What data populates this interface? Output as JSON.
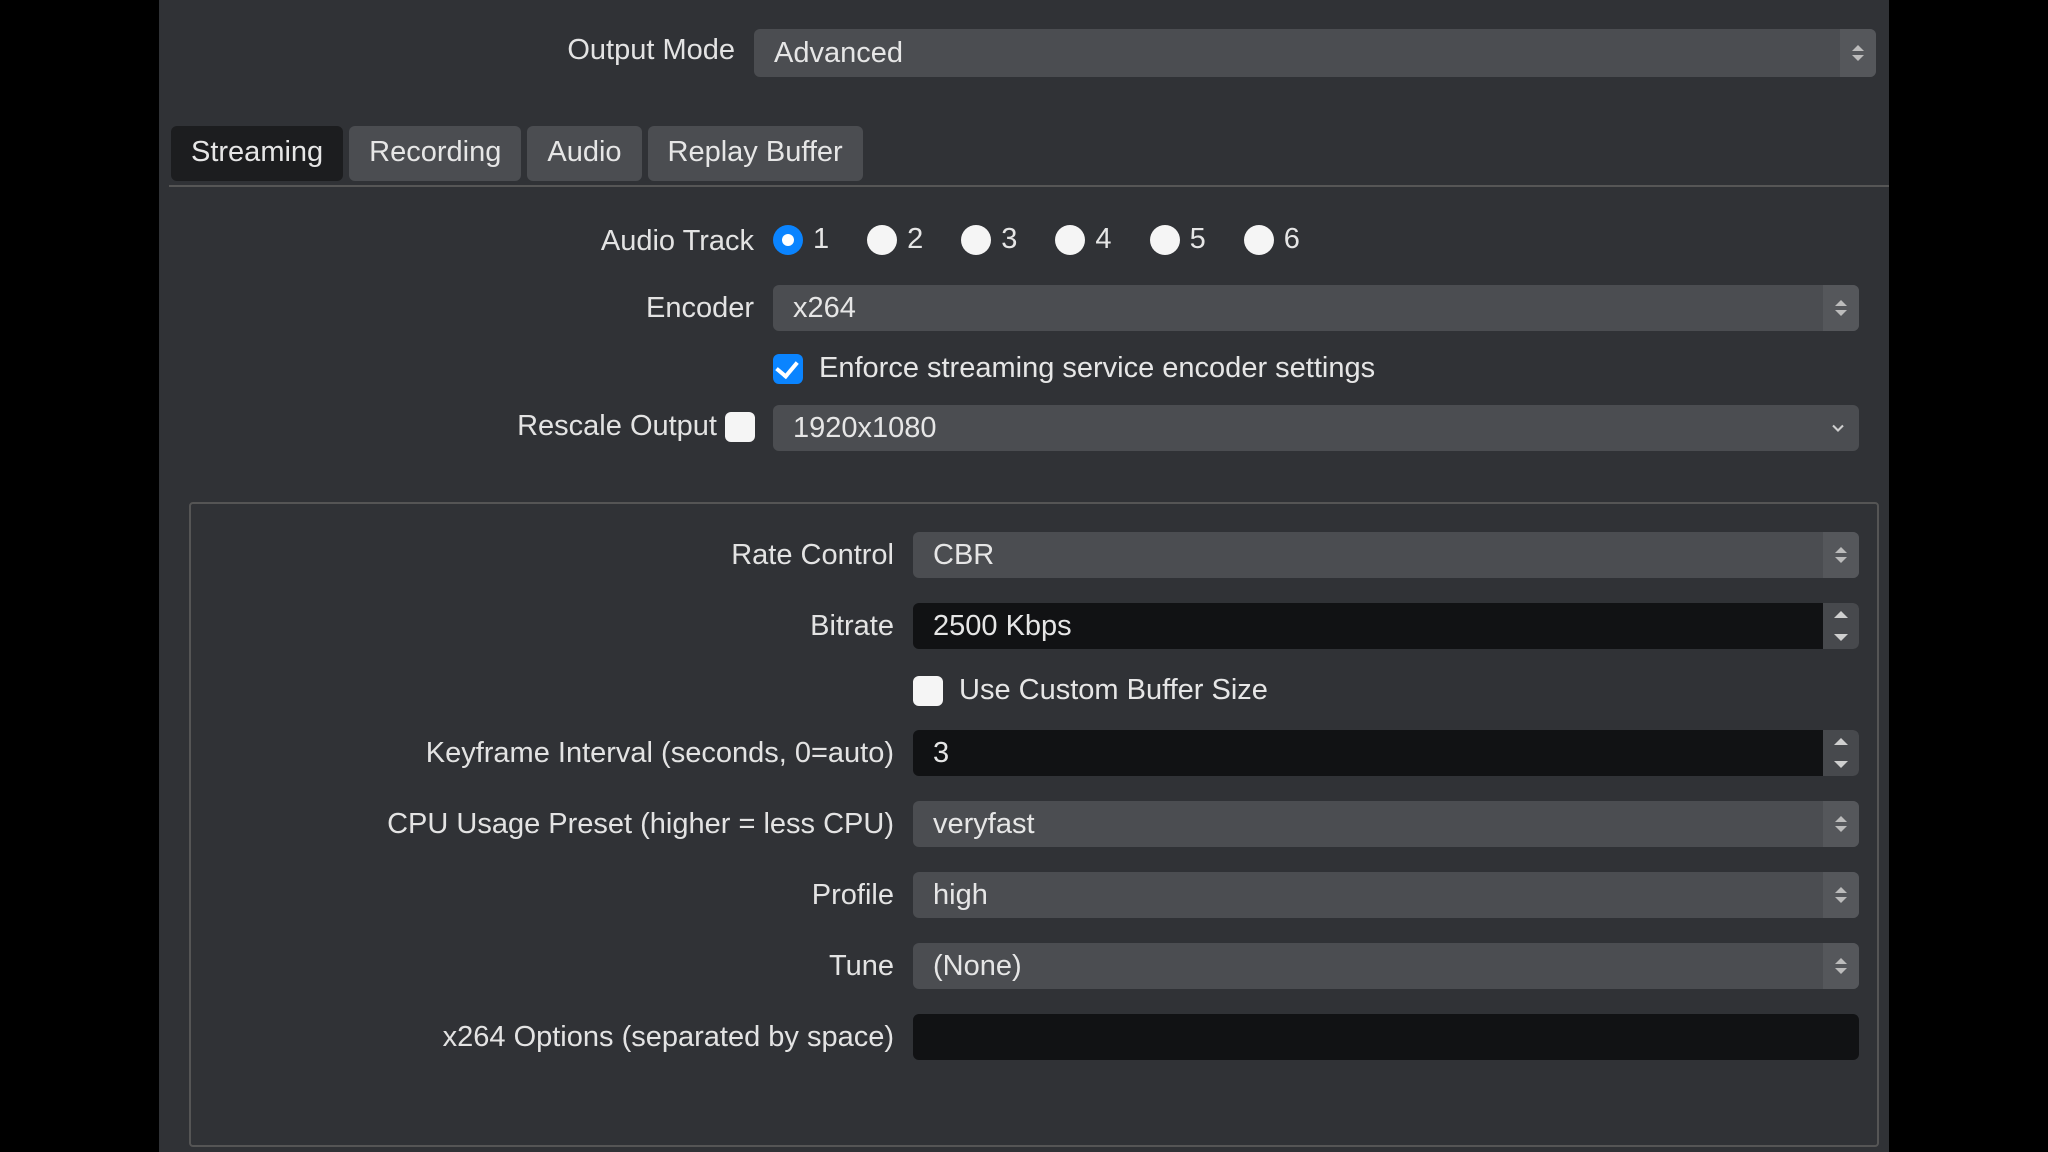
{
  "outputMode": {
    "label": "Output Mode",
    "value": "Advanced"
  },
  "tabs": {
    "streaming": "Streaming",
    "recording": "Recording",
    "audio": "Audio",
    "replayBuffer": "Replay Buffer",
    "active": "streaming"
  },
  "audioTrack": {
    "label": "Audio Track",
    "options": [
      "1",
      "2",
      "3",
      "4",
      "5",
      "6"
    ],
    "selected": "1"
  },
  "encoder": {
    "label": "Encoder",
    "value": "x264"
  },
  "enforce": {
    "label": "Enforce streaming service encoder settings",
    "checked": true
  },
  "rescale": {
    "label": "Rescale Output",
    "checked": false,
    "value": "1920x1080"
  },
  "rateControl": {
    "label": "Rate Control",
    "value": "CBR"
  },
  "bitrate": {
    "label": "Bitrate",
    "value": "2500 Kbps"
  },
  "customBuffer": {
    "label": "Use Custom Buffer Size",
    "checked": false
  },
  "keyframe": {
    "label": "Keyframe Interval (seconds, 0=auto)",
    "value": "3"
  },
  "cpuPreset": {
    "label": "CPU Usage Preset (higher = less CPU)",
    "value": "veryfast"
  },
  "profile": {
    "label": "Profile",
    "value": "high"
  },
  "tune": {
    "label": "Tune",
    "value": "(None)"
  },
  "x264opts": {
    "label": "x264 Options (separated by space)",
    "value": ""
  }
}
